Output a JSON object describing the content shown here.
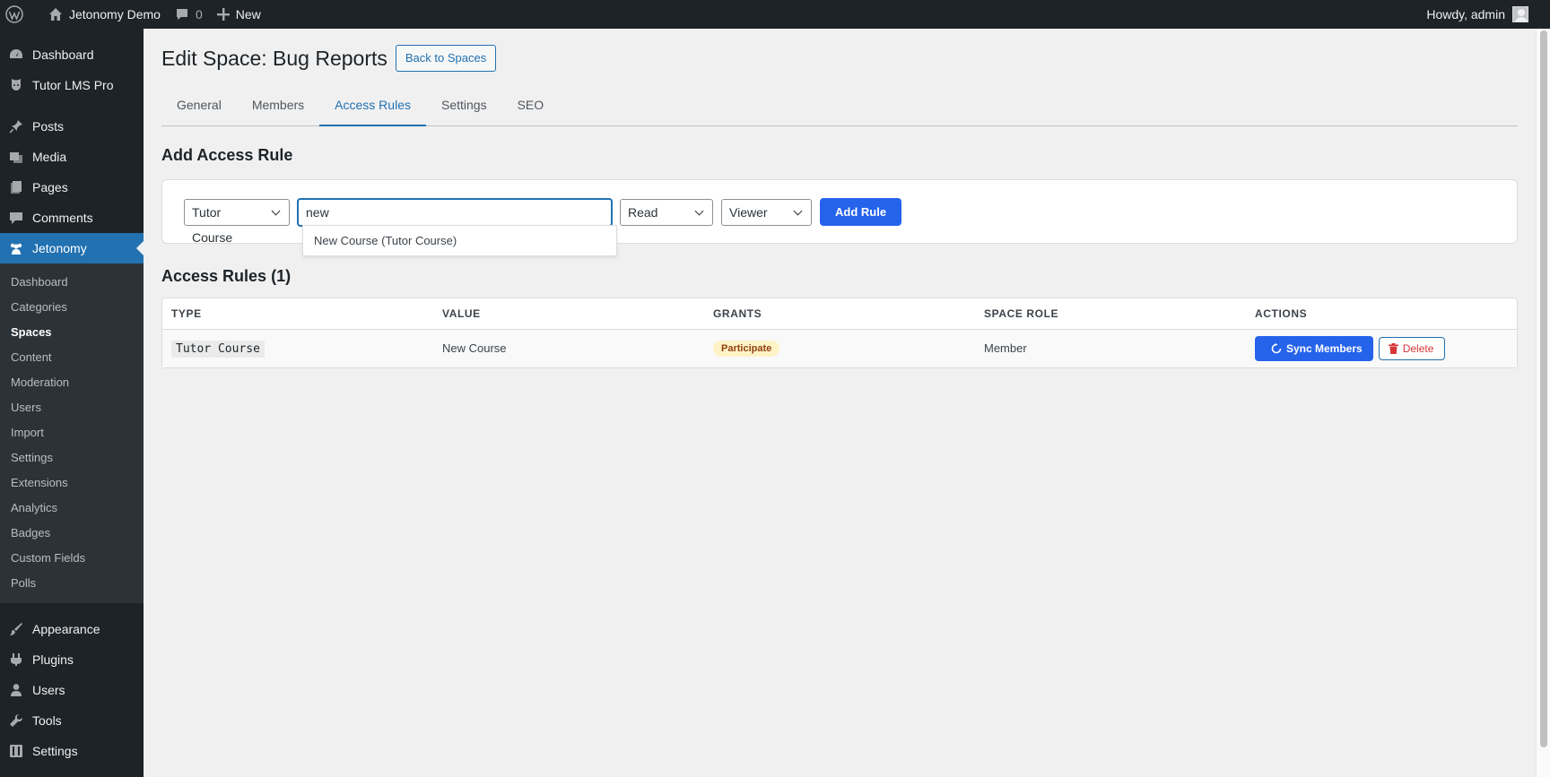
{
  "adminbar": {
    "site_name": "Jetonomy Demo",
    "comments_count": "0",
    "new_label": "New",
    "howdy": "Howdy, admin"
  },
  "sidebar": {
    "top_items": [
      {
        "label": "Dashboard",
        "icon": "dashboard-icon"
      },
      {
        "label": "Tutor LMS Pro",
        "icon": "tutor-icon"
      }
    ],
    "content_items": [
      {
        "label": "Posts",
        "icon": "pin-icon"
      },
      {
        "label": "Media",
        "icon": "media-icon"
      },
      {
        "label": "Pages",
        "icon": "pages-icon"
      },
      {
        "label": "Comments",
        "icon": "comments-icon"
      }
    ],
    "current": {
      "label": "Jetonomy",
      "icon": "groups-icon"
    },
    "submenu": [
      "Dashboard",
      "Categories",
      "Spaces",
      "Content",
      "Moderation",
      "Users",
      "Import",
      "Settings",
      "Extensions",
      "Analytics",
      "Badges",
      "Custom Fields",
      "Polls"
    ],
    "submenu_active": "Spaces",
    "bottom_items": [
      {
        "label": "Appearance",
        "icon": "appearance-icon"
      },
      {
        "label": "Plugins",
        "icon": "plugins-icon"
      },
      {
        "label": "Users",
        "icon": "users-icon"
      },
      {
        "label": "Tools",
        "icon": "tools-icon"
      },
      {
        "label": "Settings",
        "icon": "settings-icon"
      }
    ]
  },
  "page": {
    "title": "Edit Space: Bug Reports",
    "back_button": "Back to Spaces",
    "tabs": [
      "General",
      "Members",
      "Access Rules",
      "Settings",
      "SEO"
    ],
    "active_tab": "Access Rules"
  },
  "add_rule": {
    "heading": "Add Access Rule",
    "type_select": "Tutor Course",
    "search_value": "new",
    "permission_select": "Read",
    "role_select": "Viewer",
    "add_button": "Add Rule",
    "suggestion": "New Course (Tutor Course)"
  },
  "rules": {
    "heading": "Access Rules (1)",
    "columns": [
      "TYPE",
      "VALUE",
      "GRANTS",
      "SPACE ROLE",
      "ACTIONS"
    ],
    "rows": [
      {
        "type": "Tutor Course",
        "value": "New Course",
        "grants": "Participate",
        "space_role": "Member",
        "sync": "Sync Members",
        "delete": "Delete"
      }
    ]
  },
  "colors": {
    "admin_dark": "#1d2327",
    "wp_blue": "#2271b1",
    "primary_button": "#2563eb",
    "badge_bg": "#fef3c7",
    "delete_red": "#d63638"
  }
}
